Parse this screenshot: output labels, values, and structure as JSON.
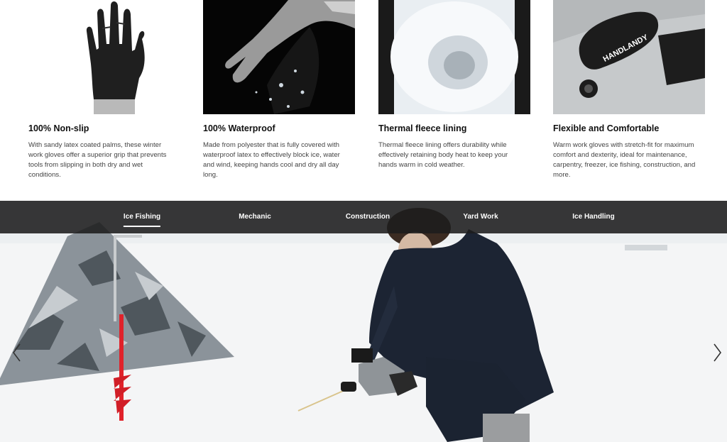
{
  "features": [
    {
      "title": "100% Non-slip",
      "text": "With sandy latex coated palms, these winter work gloves offer a superior grip that prevents tools from slipping in both dry and wet conditions."
    },
    {
      "title": "100% Waterproof",
      "text": "Made from polyester that is fully covered with waterproof latex to effectively block ice, water and wind, keeping hands cool and dry all day long."
    },
    {
      "title": "Thermal fleece lining",
      "text": "Thermal fleece lining offers durability while effectively retaining body heat to keep your hands warm in cold weather."
    },
    {
      "title": "Flexible and Comfortable",
      "text": "Warm work gloves with stretch-fit for maximum comfort and dexterity, ideal for maintenance, carpentry, freezer, ice fishing, construction, and more."
    }
  ],
  "tabs": [
    {
      "label": "Ice Fishing",
      "active": true
    },
    {
      "label": "Mechanic",
      "active": false
    },
    {
      "label": "Construction",
      "active": false
    },
    {
      "label": "Yard Work",
      "active": false
    },
    {
      "label": "Ice Handling",
      "active": false
    }
  ],
  "brand": {
    "logo_text": "HANDLANDY"
  },
  "icons": {
    "prev": "chevron-left-icon",
    "next": "chevron-right-icon"
  },
  "colors": {
    "tabbar": "#1c1c1c",
    "text": "#111111",
    "body_text": "#444444",
    "auger": "#e0222a"
  }
}
